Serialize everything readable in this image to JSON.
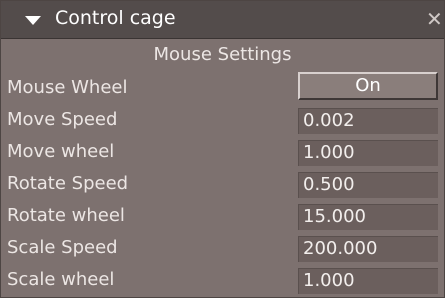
{
  "window": {
    "title": "Control cage",
    "close_glyph": "✕"
  },
  "section": {
    "title": "Mouse Settings"
  },
  "rows": [
    {
      "label": "Mouse Wheel",
      "value": "On",
      "kind": "toggle"
    },
    {
      "label": "Move Speed",
      "value": "0.002",
      "kind": "field"
    },
    {
      "label": "Move wheel",
      "value": "1.000",
      "kind": "field"
    },
    {
      "label": "Rotate Speed",
      "value": "0.500",
      "kind": "field"
    },
    {
      "label": "Rotate wheel",
      "value": "15.000",
      "kind": "field"
    },
    {
      "label": "Scale Speed",
      "value": "200.000",
      "kind": "field"
    },
    {
      "label": "Scale wheel",
      "value": "1.000",
      "kind": "field"
    }
  ],
  "icons": {
    "collapse": "chevron-down-icon",
    "close": "close-icon"
  }
}
